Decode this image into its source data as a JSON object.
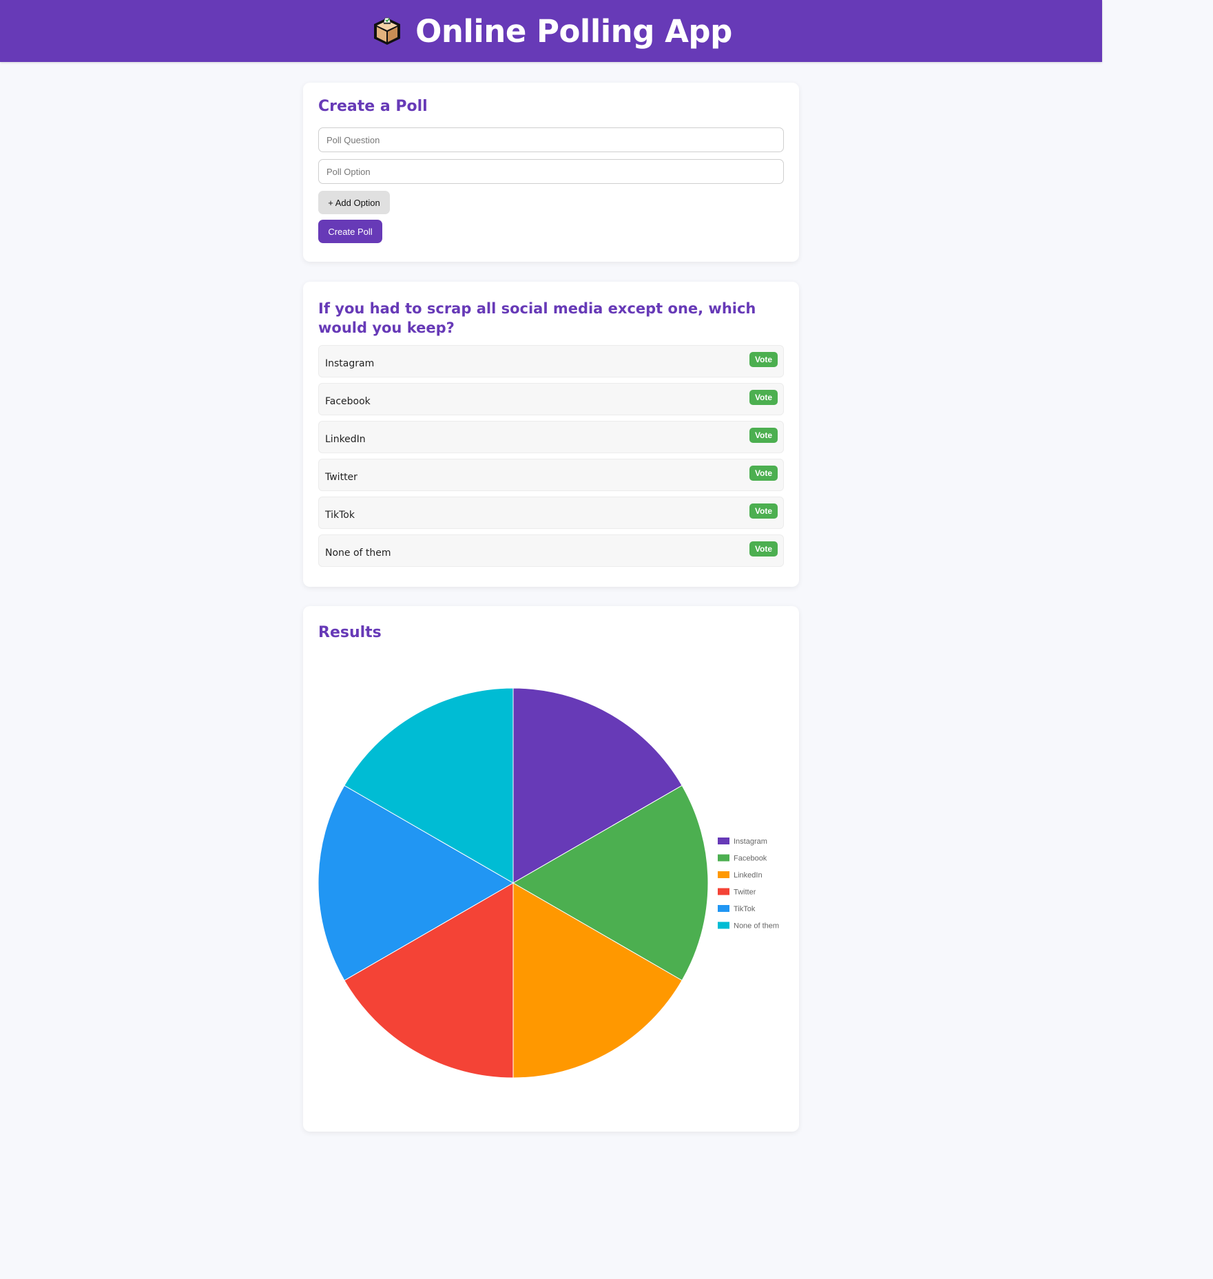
{
  "header": {
    "title": "Online Polling App",
    "icon": "ballot-box-icon"
  },
  "create_poll": {
    "title": "Create a Poll",
    "question_placeholder": "Poll Question",
    "question_value": "",
    "option_placeholder": "Poll Option",
    "option_value": "",
    "add_option_label": "+ Add Option",
    "create_label": "Create Poll"
  },
  "poll": {
    "question": "If you had to scrap all social media except one, which would you keep?",
    "vote_label": "Vote",
    "options": [
      {
        "label": "Instagram"
      },
      {
        "label": "Facebook"
      },
      {
        "label": "LinkedIn"
      },
      {
        "label": "Twitter"
      },
      {
        "label": "TikTok"
      },
      {
        "label": "None of them"
      }
    ]
  },
  "results": {
    "title": "Results"
  },
  "chart_data": {
    "type": "pie",
    "categories": [
      "Instagram",
      "Facebook",
      "LinkedIn",
      "Twitter",
      "TikTok",
      "None of them"
    ],
    "values": [
      1,
      1,
      1,
      1,
      1,
      1
    ],
    "colors": [
      "#673ab7",
      "#4caf50",
      "#ff9800",
      "#f44336",
      "#2196f3",
      "#00bcd4"
    ],
    "legend_position": "right",
    "title": ""
  },
  "colors": {
    "primary": "#673ab7",
    "vote": "#4caf50",
    "background": "#f7f8fc"
  }
}
